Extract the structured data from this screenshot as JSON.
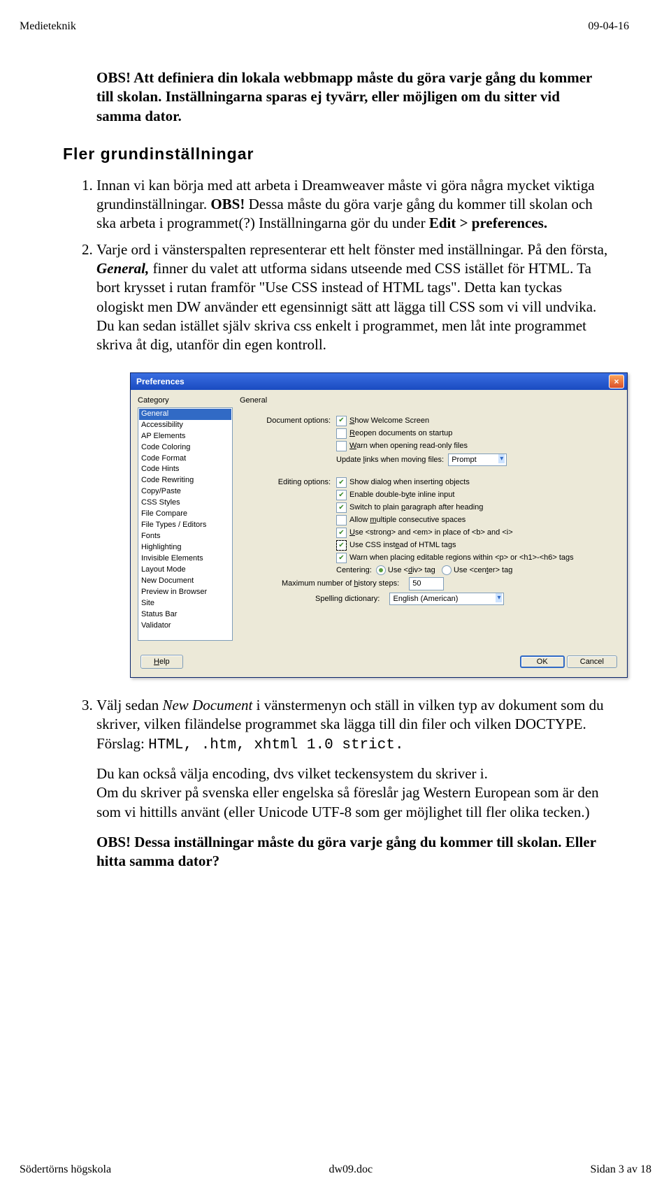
{
  "header": {
    "left": "Medieteknik",
    "right": "09-04-16"
  },
  "obs1": "OBS! Att definiera din lokala webbmapp måste du göra varje gång du kommer till skolan. Inställningarna sparas ej tyvärr, eller möjligen om du sitter vid samma dator.",
  "section_title": "Fler grundinställningar",
  "item1_a": "Innan vi kan börja med att arbeta i Dreamweaver måste vi göra några mycket viktiga grundinställningar. ",
  "item1_b": "OBS!",
  "item1_c": " Dessa måste du göra varje gång du kommer till skolan och ska arbeta i programmet(?) Inställningarna gör du under ",
  "item1_d": "Edit > preferences.",
  "item2_a": "Varje ord i vänsterspalten representerar ett helt fönster med inställningar. På den första, ",
  "item2_b": "General,",
  "item2_c": " finner du valet att utforma sidans utseende med CSS istället för HTML. Ta bort krysset i rutan framför \"Use CSS instead of HTML tags\". Detta kan tyckas ologiskt men DW använder ett egensinnigt sätt att lägga till CSS som vi vill undvika. Du kan sedan istället själv skriva css enkelt i programmet, men låt inte programmet skriva åt dig, utanför din egen kontroll.",
  "item3_a": "Välj sedan ",
  "item3_b": "New Document",
  "item3_c": " i vänstermenyn och ställ in vilken typ av dokument som du skriver, vilken filändelse programmet ska lägga till din filer och vilken DOCTYPE. Förslag: ",
  "item3_d": "HTML, .htm, xhtml 1.0 strict.",
  "item3_p2": "Du kan också välja encoding, dvs vilket teckensystem du skriver i.\nOm du skriver på svenska eller engelska så föreslår jag Western European som är den som vi hittills använt (eller Unicode UTF-8 som ger möjlighet till fler olika tecken.)",
  "item3_obs": "OBS! Dessa inställningar måste du göra varje gång du kommer till skolan. Eller hitta samma dator?",
  "dialog": {
    "title": "Preferences",
    "category_label": "Category",
    "right_title": "General",
    "categories": [
      "General",
      "Accessibility",
      "AP Elements",
      "Code Coloring",
      "Code Format",
      "Code Hints",
      "Code Rewriting",
      "Copy/Paste",
      "CSS Styles",
      "File Compare",
      "File Types / Editors",
      "Fonts",
      "Highlighting",
      "Invisible Elements",
      "Layout Mode",
      "New Document",
      "Preview in Browser",
      "Site",
      "Status Bar",
      "Validator"
    ],
    "labels": {
      "doc_options": "Document options:",
      "editing_options": "Editing options:",
      "update_links": "Update links when moving files:",
      "centering": "Centering:",
      "history": "Maximum number of history steps:",
      "spelling": "Spelling dictionary:"
    },
    "checks": {
      "welcome": "Show Welcome Screen",
      "reopen": "Reopen documents on startup",
      "warn_ro": "Warn when opening read-only files",
      "insert_dialog": "Show dialog when inserting objects",
      "doublebyte": "Enable double-byte inline input",
      "plainpara": "Switch to plain paragraph after heading",
      "multispace": "Allow multiple consecutive spaces",
      "strongem": "Use <strong> and <em> in place of <b> and <i>",
      "usecss": "Use CSS instead of HTML tags",
      "warn_regions": "Warn when placing editable regions within <p> or <h1>-<h6> tags"
    },
    "dropdowns": {
      "prompt": "Prompt",
      "spell": "English (American)"
    },
    "radios": {
      "divtag": "Use <div> tag",
      "centertag": "Use <center> tag"
    },
    "history_value": "50",
    "buttons": {
      "help": "Help",
      "ok": "OK",
      "cancel": "Cancel"
    }
  },
  "footer": {
    "left": "Södertörns högskola",
    "center": "dw09.doc",
    "right": "Sidan 3 av 18"
  }
}
